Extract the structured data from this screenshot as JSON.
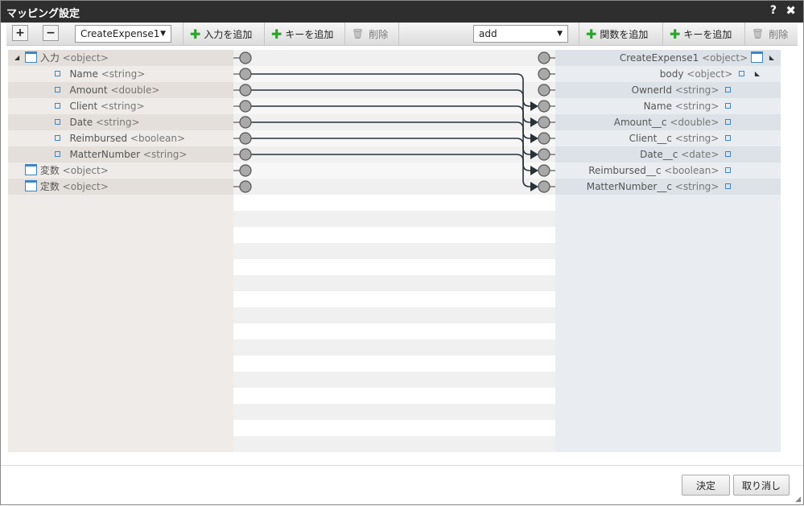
{
  "window": {
    "title": "マッピング設定",
    "help": "?",
    "close": "✖"
  },
  "toolbar": {
    "expand": "+",
    "collapse": "−",
    "source_select": "CreateExpense1",
    "add_input": "入力を追加",
    "add_key_left": "キーを追加",
    "delete_left": "削除",
    "function_select": "add",
    "add_function": "関数を追加",
    "add_key_right": "キーを追加",
    "delete_right": "削除"
  },
  "source": {
    "items": [
      {
        "name": "入力",
        "type": "<object>",
        "kind": "object",
        "expanded": true
      },
      {
        "name": "Name",
        "type": "<string>",
        "kind": "leaf"
      },
      {
        "name": "Amount",
        "type": "<double>",
        "kind": "leaf"
      },
      {
        "name": "Client",
        "type": "<string>",
        "kind": "leaf"
      },
      {
        "name": "Date",
        "type": "<string>",
        "kind": "leaf"
      },
      {
        "name": "Reimbursed",
        "type": "<boolean>",
        "kind": "leaf"
      },
      {
        "name": "MatterNumber",
        "type": "<string>",
        "kind": "leaf"
      },
      {
        "name": "変数",
        "type": "<object>",
        "kind": "object"
      },
      {
        "name": "定数",
        "type": "<object>",
        "kind": "object"
      }
    ]
  },
  "target": {
    "items": [
      {
        "name": "CreateExpense1",
        "type": "<object>",
        "kind": "object"
      },
      {
        "name": "body",
        "type": "<object>",
        "kind": "leaf-branch"
      },
      {
        "name": "OwnerId",
        "type": "<string>",
        "kind": "leaf"
      },
      {
        "name": "Name",
        "type": "<string>",
        "kind": "leaf"
      },
      {
        "name": "Amount__c",
        "type": "<double>",
        "kind": "leaf"
      },
      {
        "name": "Client__c",
        "type": "<string>",
        "kind": "leaf"
      },
      {
        "name": "Date__c",
        "type": "<date>",
        "kind": "leaf"
      },
      {
        "name": "Reimbursed__c",
        "type": "<boolean>",
        "kind": "leaf"
      },
      {
        "name": "MatterNumber__c",
        "type": "<string>",
        "kind": "leaf"
      }
    ]
  },
  "mappings": [
    {
      "from": 1,
      "to": 3
    },
    {
      "from": 2,
      "to": 4
    },
    {
      "from": 3,
      "to": 5
    },
    {
      "from": 4,
      "to": 6
    },
    {
      "from": 5,
      "to": 7
    },
    {
      "from": 6,
      "to": 8
    }
  ],
  "footer": {
    "ok": "決定",
    "cancel": "取り消し"
  },
  "colors": {
    "titlebar": "#2e2e2e",
    "source_panel": "#eeebe8",
    "target_panel": "#e9edf1",
    "accent": "#3b85c9",
    "add": "#2aa52a"
  }
}
